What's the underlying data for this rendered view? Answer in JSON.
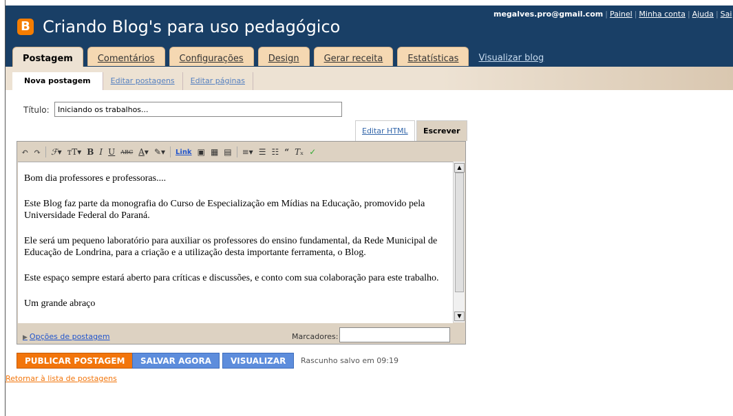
{
  "header": {
    "logo_letter": "B",
    "blog_title": "Criando Blog's para uso pedagógico",
    "email": "megalves.pro@gmail.com",
    "links": [
      "Painel",
      "Minha conta",
      "Ajuda",
      "Sai"
    ]
  },
  "tabs": [
    {
      "label": "Postagem",
      "active": true
    },
    {
      "label": "Comentários"
    },
    {
      "label": "Configurações"
    },
    {
      "label": "Design"
    },
    {
      "label": "Gerar receita"
    },
    {
      "label": "Estatísticas"
    }
  ],
  "view_blog": "Visualizar blog",
  "subtabs": [
    {
      "label": "Nova postagem",
      "active": true
    },
    {
      "label": "Editar postagens"
    },
    {
      "label": "Editar páginas"
    }
  ],
  "form": {
    "title_label": "Título:",
    "title_value": "Iniciando os trabalhos...",
    "edit_html_tab": "Editar HTML",
    "write_tab": "Escrever",
    "toolbar_link": "Link",
    "paragraphs": [
      "Bom dia professores e professoras....",
      "Este Blog faz parte da monografia do Curso de Especialização em Mídias na Educação, promovido pela Universidade Federal do Paraná.",
      "Ele será um pequeno laboratório para auxiliar os professores do ensino fundamental, da Rede Municipal de Educação de Londrina, para a criação e a utilização desta importante ferramenta, o Blog.",
      "Este espaço sempre estará aberto para críticas e discussões, e conto com sua colaboração para este trabalho.",
      "Um grande abraço"
    ],
    "post_options": "Opções de postagem",
    "labels_label": "Marcadores:"
  },
  "actions": {
    "publish": "PUBLICAR POSTAGEM",
    "save": "SALVAR AGORA",
    "preview": "VISUALIZAR",
    "draft_status": "Rascunho salvo em 09:19",
    "back_link": "Retornar à lista de postagens"
  },
  "colors": {
    "header": "#193f66",
    "accent": "#f2750b",
    "button_blue": "#5d8ddc"
  }
}
